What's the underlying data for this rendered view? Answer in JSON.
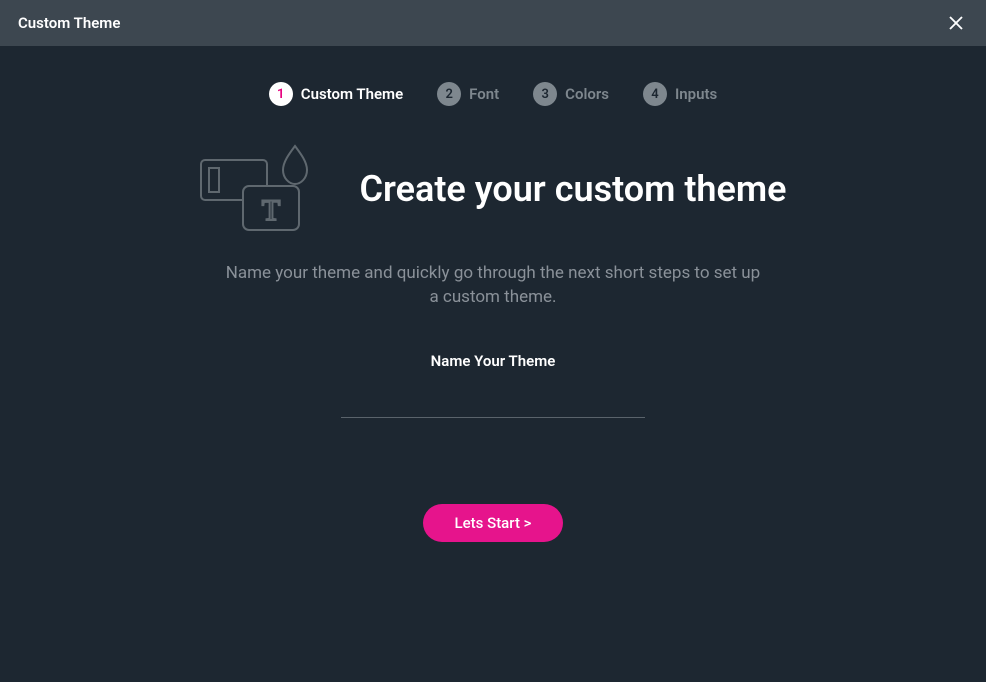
{
  "header": {
    "title": "Custom Theme"
  },
  "stepper": {
    "steps": [
      {
        "num": "1",
        "label": "Custom Theme",
        "active": true
      },
      {
        "num": "2",
        "label": "Font",
        "active": false
      },
      {
        "num": "3",
        "label": "Colors",
        "active": false
      },
      {
        "num": "4",
        "label": "Inputs",
        "active": false
      }
    ]
  },
  "hero": {
    "title": "Create your custom theme"
  },
  "description": "Name your theme and quickly go through the next short steps to set up a custom theme.",
  "field": {
    "label": "Name Your Theme",
    "value": ""
  },
  "cta": {
    "label": "Lets Start >"
  }
}
